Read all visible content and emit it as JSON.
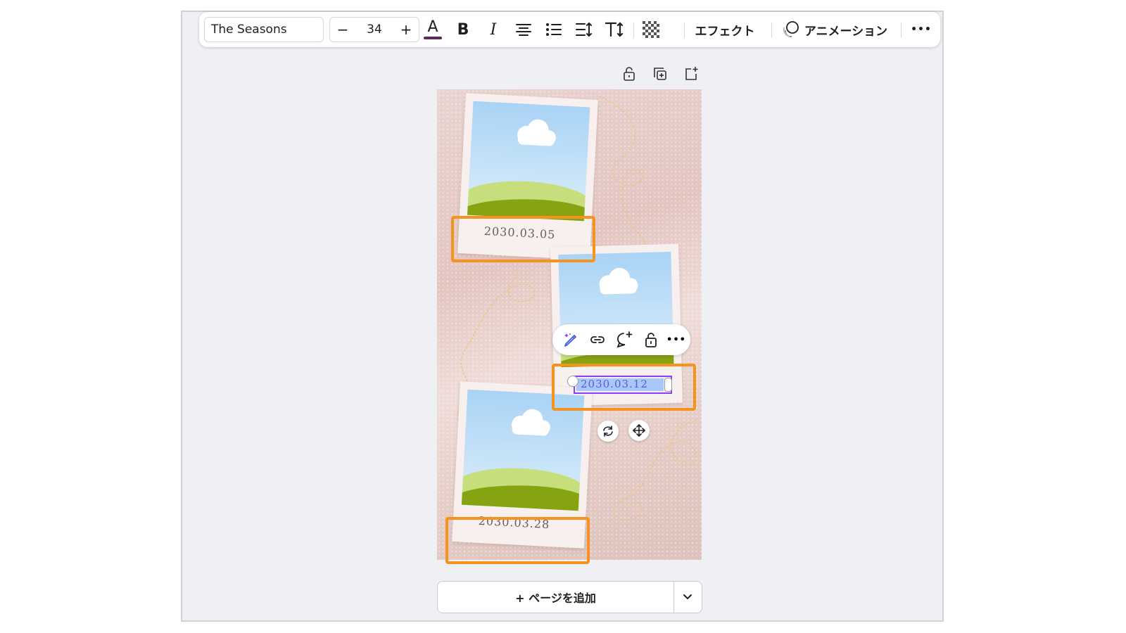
{
  "toolbar": {
    "font_name": "The Seasons",
    "font_size": "34",
    "decrease_label": "−",
    "increase_label": "+",
    "bold_label": "B",
    "italic_label": "I",
    "text_color_label": "A",
    "text_color": "#5b2a55",
    "effects_label": "エフェクト",
    "animation_label": "アニメーション",
    "more_label": "•••"
  },
  "canvas": {
    "photos": [
      {
        "date": "2030.03.05"
      },
      {
        "date": "2030.03.12"
      },
      {
        "date": "2030.03.28"
      }
    ]
  },
  "selection": {
    "text": "2030.03.12"
  },
  "floating_toolbar": {
    "more_label": "•••"
  },
  "add_page": {
    "label": "+ ページを追加"
  },
  "colors": {
    "highlight": "#f6921e",
    "selection_border": "#8b3dff",
    "selection_fill": "#a8c7fa"
  }
}
